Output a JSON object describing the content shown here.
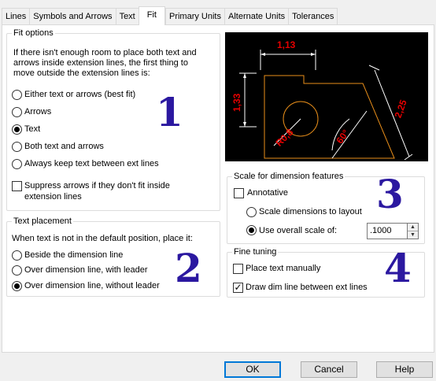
{
  "tabs": [
    "Lines",
    "Symbols and Arrows",
    "Text",
    "Fit",
    "Primary Units",
    "Alternate Units",
    "Tolerances"
  ],
  "fit_options": {
    "title": "Fit options",
    "description_lines": [
      "If there isn't enough room to place both text and",
      "arrows inside extension lines, the first thing to",
      "move outside the extension lines is:"
    ],
    "options": [
      "Either text or arrows (best fit)",
      "Arrows",
      "Text",
      "Both text and arrows",
      "Always keep text between ext lines"
    ],
    "selected": "Text",
    "suppress_label_lines": [
      "Suppress arrows if they don't fit inside",
      "extension lines"
    ],
    "suppress_checked": false
  },
  "text_placement": {
    "title": "Text placement",
    "description": "When text is not in the default position, place it:",
    "options": [
      "Beside the dimension line",
      "Over dimension line, with leader",
      "Over dimension line, without leader"
    ],
    "selected": "Over dimension line, without leader"
  },
  "preview": {
    "dim_labels": [
      "1,13",
      "1,33",
      "2,25",
      "R0,8",
      "60°"
    ],
    "dim_color": "#e60000"
  },
  "scale": {
    "title": "Scale for dimension features",
    "annotative_label": "Annotative",
    "annotative_checked": false,
    "options": [
      "Scale dimensions to layout",
      "Use overall scale of:"
    ],
    "selected": "Use overall scale of:",
    "overall_scale_value": ".1000"
  },
  "fine_tuning": {
    "title": "Fine tuning",
    "place_manually_label": "Place text manually",
    "place_manually_checked": false,
    "draw_dim_line_label": "Draw dim line between ext lines",
    "draw_dim_line_checked": true
  },
  "annotations": [
    "1",
    "2",
    "3",
    "4"
  ],
  "buttons": {
    "ok": "OK",
    "cancel": "Cancel",
    "help": "Help"
  }
}
